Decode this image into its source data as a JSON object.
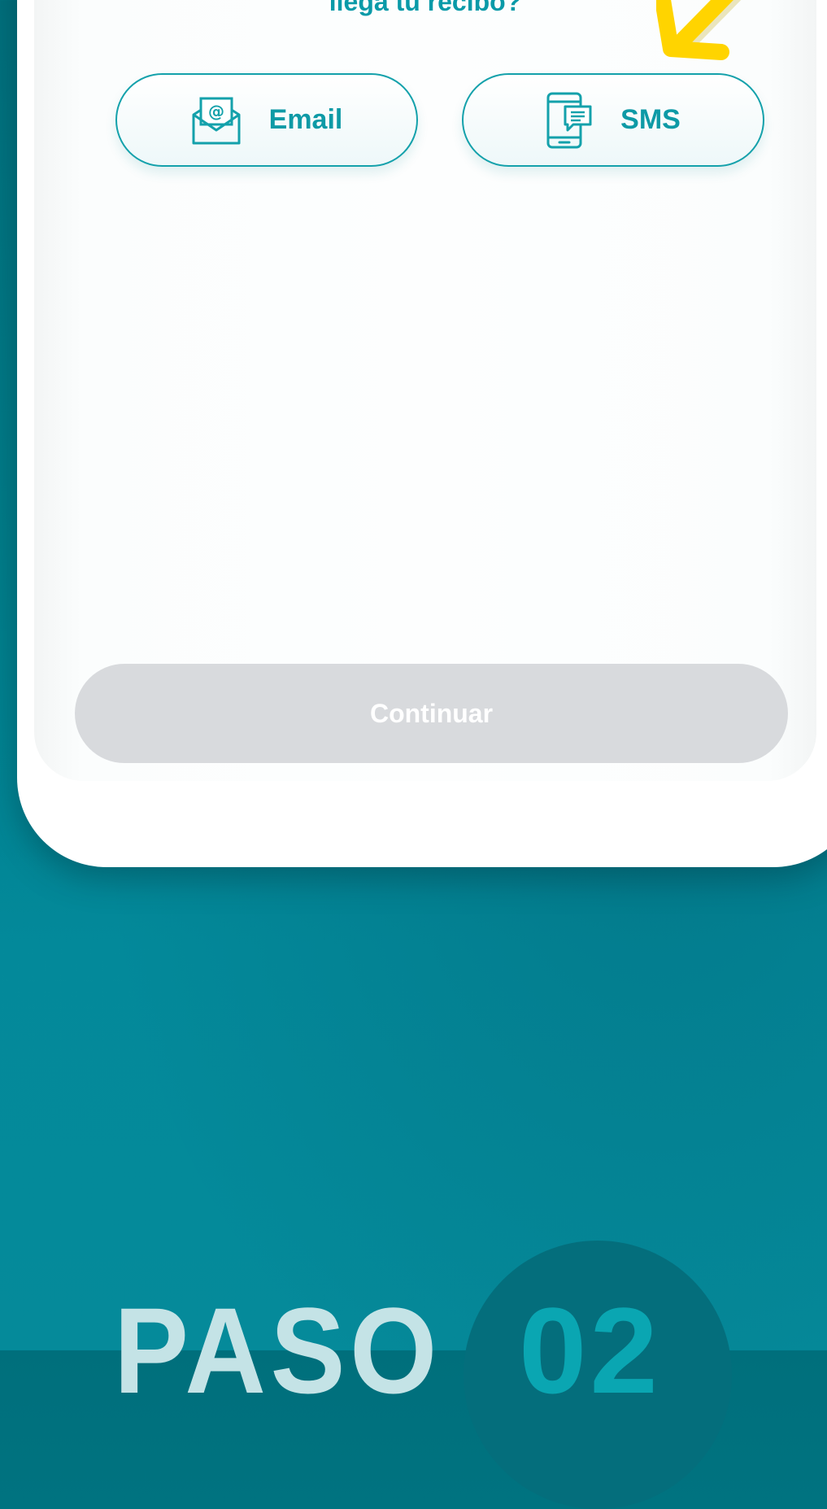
{
  "prompt": {
    "title_fragment": "llega tu recibo?"
  },
  "channels": [
    {
      "label": "Email",
      "icon": "envelope-at-icon"
    },
    {
      "label": "SMS",
      "icon": "phone-message-icon"
    }
  ],
  "continue_button": {
    "label": "Continuar",
    "state": "disabled"
  },
  "step": {
    "word": "PASO",
    "number": "02"
  },
  "colors": {
    "accent": "#0e9aa6",
    "arrow": "#ffd400",
    "disabled_button": "#d8dadd",
    "background": "#007d8a"
  }
}
